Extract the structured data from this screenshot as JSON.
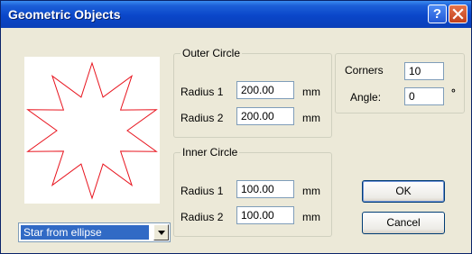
{
  "window": {
    "title": "Geometric Objects",
    "help_glyph": "?",
    "close_glyph": "✕"
  },
  "preview": {
    "star_color": "#e8141e",
    "points": 10
  },
  "shape_select": {
    "selected": "Star from ellipse"
  },
  "outer_circle": {
    "title": "Outer Circle",
    "radius1_label": "Radius 1",
    "radius1_value": "200.00",
    "radius1_unit": "mm",
    "radius2_label": "Radius 2",
    "radius2_value": "200.00",
    "radius2_unit": "mm"
  },
  "inner_circle": {
    "title": "Inner Circle",
    "radius1_label": "Radius 1",
    "radius1_value": "100.00",
    "radius1_unit": "mm",
    "radius2_label": "Radius 2",
    "radius2_value": "100.00",
    "radius2_unit": "mm"
  },
  "polygon": {
    "corners_label": "Corners",
    "corners_value": "10",
    "angle_label": "Angle:",
    "angle_value": "0",
    "angle_unit": "°"
  },
  "buttons": {
    "ok": "OK",
    "cancel": "Cancel"
  }
}
